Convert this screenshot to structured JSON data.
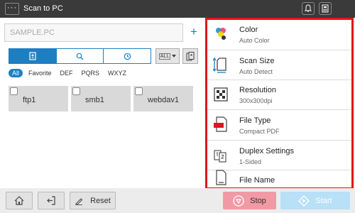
{
  "header": {
    "menu_label": "···",
    "title": "Scan to PC"
  },
  "destination": {
    "value": "SAMPLE.PC",
    "add_label": "+"
  },
  "view": {
    "all_label": "ALL"
  },
  "filters": [
    "All",
    "Favorite",
    "DEF",
    "PQRS",
    "WXYZ"
  ],
  "tiles": [
    "ftp1",
    "smb1",
    "webdav1"
  ],
  "settings": [
    {
      "label": "Color",
      "value": "Auto Color",
      "icon": "color-icon"
    },
    {
      "label": "Scan Size",
      "value": "Auto Detect",
      "icon": "scan-size-icon"
    },
    {
      "label": "Resolution",
      "value": "300x300dpi",
      "icon": "resolution-icon"
    },
    {
      "label": "File Type",
      "value": "Compact PDF",
      "icon": "pdf-file-icon"
    },
    {
      "label": "Duplex Settings",
      "value": "1-Sided",
      "icon": "duplex-icon"
    },
    {
      "label": "File Name",
      "icon": "file-icon"
    }
  ],
  "footer": {
    "reset_label": "Reset",
    "stop_label": "Stop",
    "start_label": "Start"
  },
  "colors": {
    "accent": "#1d7fc1",
    "highlight_border": "#e0161b",
    "stop": "#f19aa6",
    "start": "#b8e0f7"
  }
}
